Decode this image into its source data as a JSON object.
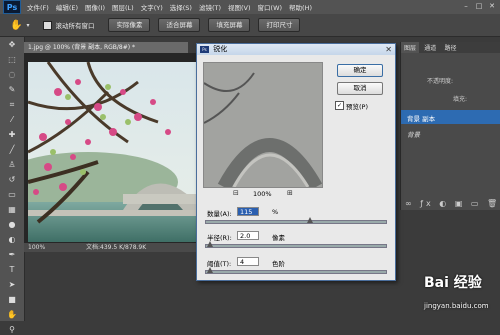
{
  "menu": {
    "logo": "Ps",
    "items": [
      "文件(F)",
      "编辑(E)",
      "图像(I)",
      "图层(L)",
      "文字(Y)",
      "选择(S)",
      "滤镜(T)",
      "视图(V)",
      "窗口(W)",
      "帮助(H)"
    ]
  },
  "options": {
    "scroll_all_windows": "滚动所有窗口",
    "actual_pixels": "实际像素",
    "fit_screen": "适合屏幕",
    "fill_screen": "填充屏幕",
    "print_size": "打印尺寸"
  },
  "document": {
    "tab_label": "1.jpg @ 100% (背景 副本, RGB/8#) *",
    "zoom": "100%",
    "doc_info": "文档:439.5 K/878.9K"
  },
  "right_panel": {
    "tabs": [
      "图层",
      "通道",
      "路径"
    ],
    "opacity_label": "不透明度:",
    "fill_label": "填充:",
    "layer_name": "背景 副本",
    "layer_bg": "背景"
  },
  "dialog": {
    "title": "锐化",
    "ok": "确定",
    "cancel": "取消",
    "preview_label": "预览(P)",
    "preview_checked": true,
    "preview_zoom": "100%",
    "amount_label": "数量(A):",
    "amount_value": "115",
    "amount_unit": "%",
    "amount_level": 0.58,
    "radius_label": "半径(R):",
    "radius_value": "2.0",
    "radius_unit": "像素",
    "radius_level": 0.02,
    "threshold_label": "阈值(T):",
    "threshold_value": "4",
    "threshold_unit": "色阶",
    "threshold_level": 0.02
  },
  "watermark": {
    "brand": "Bai 经验",
    "url": "jingyan.baidu.com"
  }
}
